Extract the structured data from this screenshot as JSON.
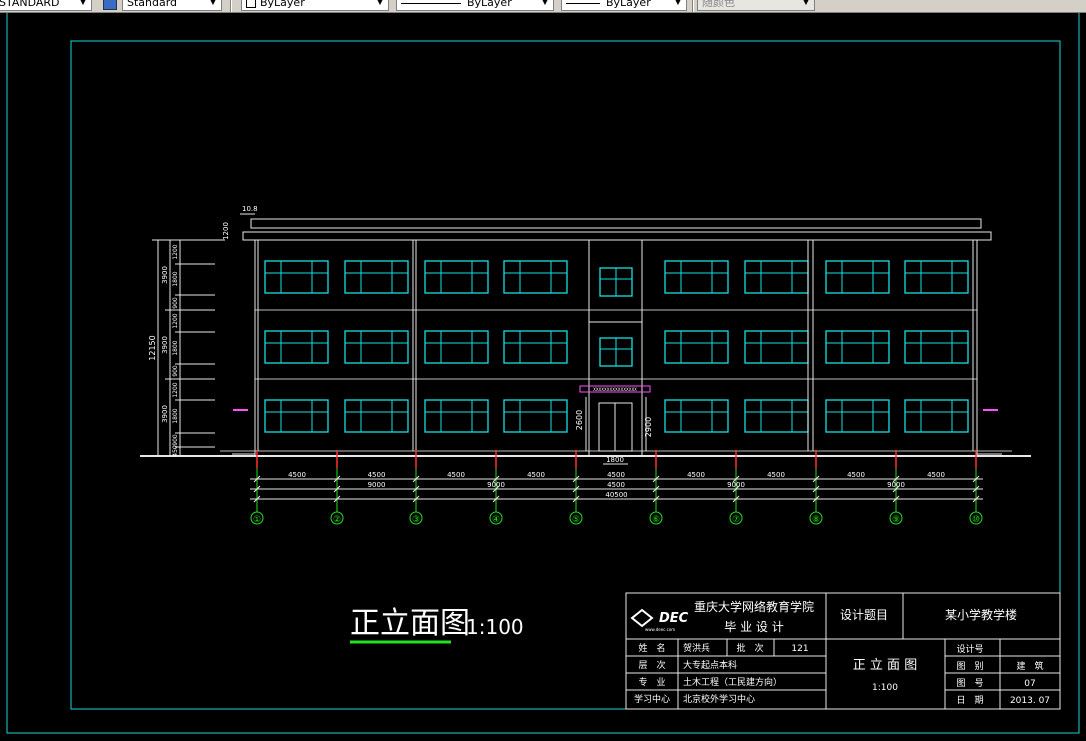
{
  "toolbar": {
    "text_style": "STANDARD",
    "dim_style": "Standard",
    "layer": "ByLayer",
    "linetype": "ByLayer",
    "lineweight": "ByLayer",
    "plot_style": "随颜色"
  },
  "drawing": {
    "axes": [
      "①",
      "②",
      "③",
      "④",
      "⑤",
      "⑥",
      "⑦",
      "⑧",
      "⑨",
      "⑩"
    ],
    "bay_dims": [
      "4500",
      "4500",
      "4500",
      "4500",
      "4500",
      "4500",
      "4500",
      "4500",
      "4500"
    ],
    "group_dims": [
      "9000",
      "9000",
      "9000",
      "9000"
    ],
    "group_centre_dim": "4500",
    "total_dim": "40500",
    "door_dim": "1800",
    "left_total_dim": "12150",
    "left_floor_dims": [
      "3900",
      "3900",
      "3900"
    ],
    "left_sub_dims": [
      "1200",
      "1800",
      "900",
      "1200",
      "1800",
      "900",
      "1200",
      "1800",
      "900",
      "450"
    ],
    "parapet_dim": "1200",
    "roof_level": "10.8",
    "entrance_dims": [
      "2600",
      "2900"
    ],
    "sign_text": "XXXXXXXXXXXXXXXX"
  },
  "title": {
    "text": "正立面图",
    "scale": "1:100"
  },
  "titleblock": {
    "logo": "DEC",
    "logo_sub": "www.deec.com",
    "school": "重庆大学网络教育学院",
    "subtitle": "毕 业 设 计",
    "topic_label": "设计题目",
    "topic": "某小学教学楼",
    "rows": [
      {
        "label": "姓　名",
        "value": "贺洪兵",
        "label2": "批　次",
        "value2": "121"
      },
      {
        "label": "层　次",
        "value": "大专起点本科"
      },
      {
        "label": "专　业",
        "value": "土木工程（工民建方向）"
      },
      {
        "label": "学习中心",
        "value": "北京校外学习中心"
      }
    ],
    "drawing_name": "正 立 面 图",
    "drawing_scale": "1:100",
    "right_rows": [
      {
        "label": "设计号",
        "value": ""
      },
      {
        "label": "图　别",
        "value": "建　筑"
      },
      {
        "label": "图　号",
        "value": "07"
      },
      {
        "label": "日　期",
        "value": "2013. 07"
      }
    ]
  }
}
